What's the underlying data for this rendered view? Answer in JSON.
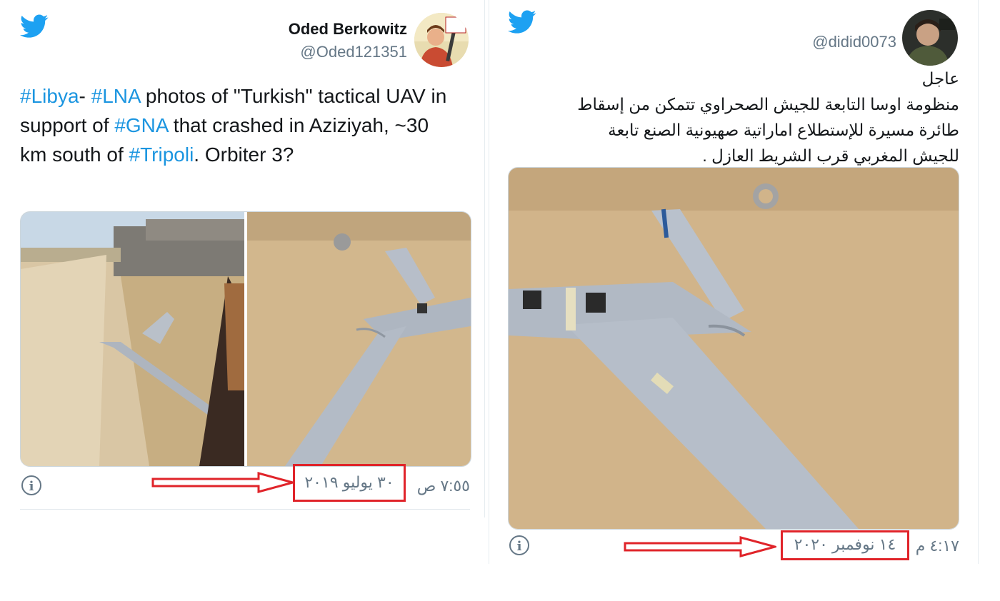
{
  "tweet1": {
    "name": "Oded Berkowitz",
    "handle": "@Oded121351",
    "avatar_text": "RIFLE IS FINE!",
    "text_parts": [
      {
        "text": "#Libya",
        "tag": true
      },
      {
        "text": "- ",
        "tag": false
      },
      {
        "text": "#LNA",
        "tag": true
      },
      {
        "text": " photos of \"Turkish\" tactical UAV in support of ",
        "tag": false
      },
      {
        "text": "#GNA",
        "tag": true
      },
      {
        "text": " that crashed in Aziziyah, ~30 km south of ",
        "tag": false
      },
      {
        "text": "#Tripoli",
        "tag": true
      },
      {
        "text": ". Orbiter 3?",
        "tag": false
      }
    ],
    "time": "٧:٥٥ ص",
    "date": "٣٠ يوليو ٢٠١٩"
  },
  "tweet2": {
    "handle": "@didid0073",
    "text_lines": [
      "عاجل",
      "منظومة اوسا التابعة للجيش الصحراوي تتمكن من إسقاط",
      "طائرة مسيرة للإستطلاع اماراتية صهيونية الصنع تابعة",
      "للجيش المغربي قرب الشريط العازل ."
    ],
    "time": "٤:١٧ م",
    "date": "١٤ نوفمبر ٢٠٢٠"
  },
  "icons": {
    "bird": "twitter-bird-icon",
    "info": "info-icon",
    "arrow": "red-arrow-icon"
  },
  "colors": {
    "twitter_blue": "#1da1f2",
    "hashtag": "#1b95e0",
    "annotation_red": "#e0242a",
    "muted": "#657786"
  }
}
